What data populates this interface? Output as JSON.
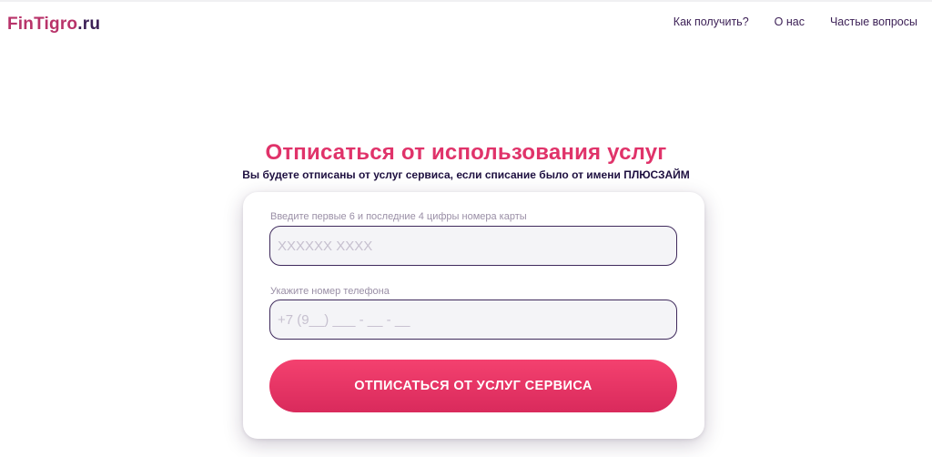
{
  "header": {
    "logo_brand": "FinTigro",
    "logo_tld": ".ru",
    "nav": [
      {
        "label": "Как получить?"
      },
      {
        "label": "О нас"
      },
      {
        "label": "Частые вопросы"
      }
    ]
  },
  "hero": {
    "title": "Отписаться от использования услуг",
    "subtitle": "Вы будете отписаны от услуг сервиса, если списание было от имени ПЛЮСЗАЙМ"
  },
  "form": {
    "card_label": "Введите первые 6 и последние 4 цифры номера карты",
    "card_placeholder": "XXXXXX XXXX",
    "card_value": "",
    "phone_label": "Укажите номер телефона",
    "phone_placeholder": "+7 (9__) ___ - __ - __",
    "phone_value": "",
    "submit_label": "ОТПИСАТЬСЯ ОТ УСЛУГ СЕРВИСА"
  },
  "colors": {
    "accent": "#e0336a",
    "brand_dark": "#3b1f55",
    "button_gradient_top": "#f4416f",
    "button_gradient_bottom": "#d92a5c"
  }
}
